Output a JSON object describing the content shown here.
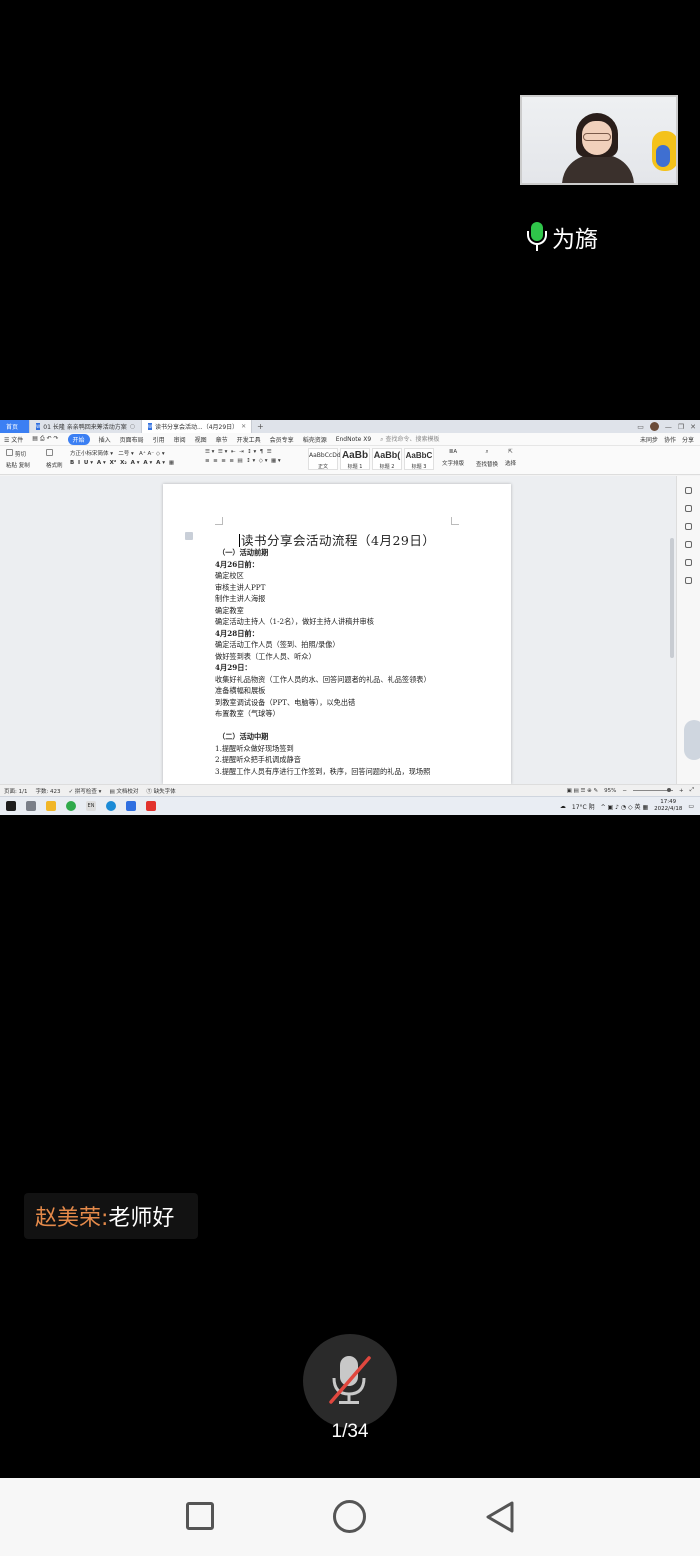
{
  "video": {
    "speaker_name": "为旖"
  },
  "desktop": {
    "tabs": {
      "home": "首页",
      "tab1": "01 长隆 亲亲鸭回来筹活动方案",
      "tab2": "读书分享会活动...（4月29日）",
      "plus": "+"
    },
    "menu": {
      "file": "☰ 文件",
      "items": [
        "开始",
        "插入",
        "页面布局",
        "引用",
        "审阅",
        "视图",
        "章节",
        "开发工具",
        "会员专享",
        "稻壳资源",
        "EndNote X9"
      ],
      "active": "开始",
      "search": "查找命令、搜索模板",
      "right": [
        "未同步",
        "协作",
        "分享"
      ]
    },
    "ribbon": {
      "font_name": "方正小标宋简体",
      "font_size": "二号",
      "format_painter": "格式刷",
      "paste": "粘贴",
      "cut": "剪切",
      "copy": "复制",
      "styles": [
        {
          "preview": "AaBbCcDd",
          "label": "正文"
        },
        {
          "preview": "AaBb",
          "label": "标题 1"
        },
        {
          "preview": "AaBb(",
          "label": "标题 2"
        },
        {
          "preview": "AaBbC",
          "label": "标题 3"
        }
      ],
      "text_layout": "文字排版",
      "find_replace": "查找替换",
      "select": "选择"
    },
    "document": {
      "title": "读书分享会活动流程（4月29日）",
      "lines": [
        {
          "text": "（一）活动前期",
          "bold": true,
          "indent": true
        },
        {
          "text": "4月26日前：",
          "bold": true
        },
        {
          "text": "确定校区"
        },
        {
          "text": "审核主讲人PPT"
        },
        {
          "text": "制作主讲人海报"
        },
        {
          "text": "确定教室"
        },
        {
          "text": "确定活动主持人（1-2名），做好主持人讲稿并审核"
        },
        {
          "text": "4月28日前：",
          "bold": true
        },
        {
          "text": "确定活动工作人员（签到、拍照/录像）"
        },
        {
          "text": "做好签到表（工作人员、听众）"
        },
        {
          "text": "4月29日：",
          "bold": true
        },
        {
          "text": "收集好礼品物资（工作人员的水、回答问题者的礼品、礼品签领表）"
        },
        {
          "text": "准备横幅和展板"
        },
        {
          "text": "到教室调试设备（PPT、电脑等），以免出错"
        },
        {
          "text": "布置教室（气球等）"
        },
        {
          "text": ""
        },
        {
          "text": "（二）活动中期",
          "bold": true,
          "indent": true
        },
        {
          "text": "1.提醒听众做好现场签到"
        },
        {
          "text": "2.提醒听众把手机调成静音"
        },
        {
          "text": "3.提醒工作人员有序进行工作签到，秩序，回答问题的礼品，现场照"
        }
      ]
    },
    "status": {
      "page": "页面: 1/1",
      "words": "字数: 423",
      "spell": "拼写检查",
      "doc_check": "文档校对",
      "missing_font": "缺失字体",
      "zoom": "95%"
    },
    "taskbar": {
      "weather": "17°C 阴",
      "time": "17:49",
      "date": "2022/4/18",
      "lang": "EN"
    }
  },
  "chat": {
    "name": "赵美荣:",
    "message": " 老师好"
  },
  "controls": {
    "page_counter": "1/34"
  }
}
